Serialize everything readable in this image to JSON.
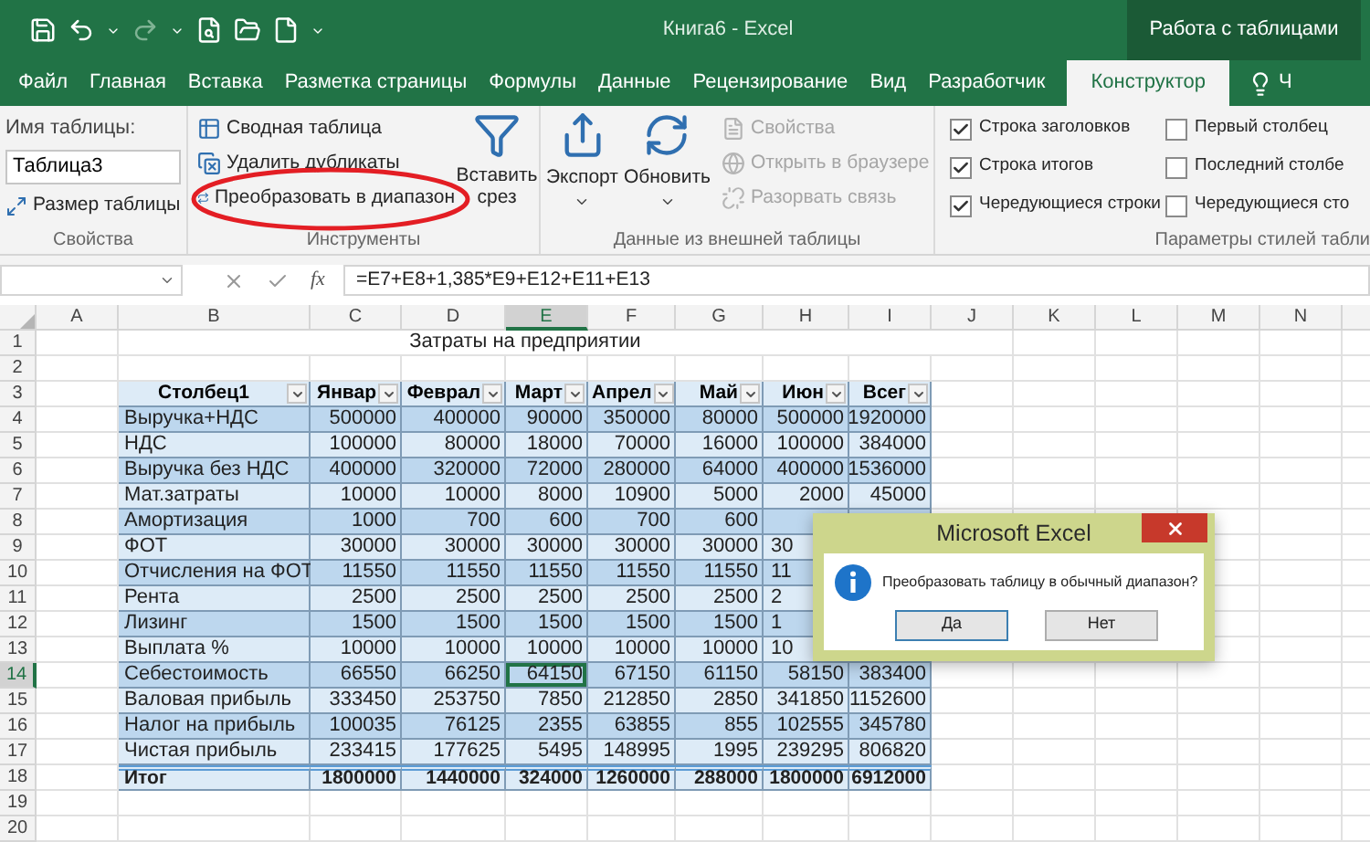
{
  "title_bar": {
    "document_title": "Книга6 - Excel",
    "context_label": "Работа с таблицами"
  },
  "ribbon_tabs": [
    {
      "label": "Файл",
      "selected": false
    },
    {
      "label": "Главная",
      "selected": false
    },
    {
      "label": "Вставка",
      "selected": false
    },
    {
      "label": "Разметка страницы",
      "selected": false
    },
    {
      "label": "Формулы",
      "selected": false
    },
    {
      "label": "Данные",
      "selected": false
    },
    {
      "label": "Рецензирование",
      "selected": false
    },
    {
      "label": "Вид",
      "selected": false
    },
    {
      "label": "Разработчик",
      "selected": false
    },
    {
      "label": "Конструктор",
      "selected": true
    }
  ],
  "tell_me": {
    "label": "Ч"
  },
  "ribbon_groups": [
    {
      "kind": "properties",
      "title": "Свойства",
      "name_label": "Имя таблицы:",
      "name_value": "Таблица3",
      "button": "Размер таблицы"
    },
    {
      "kind": "tools",
      "title": "Инструменты",
      "items": [
        {
          "label": "Сводная таблица",
          "disabled": false
        },
        {
          "label": "Удалить дубликаты",
          "disabled": false
        },
        {
          "label": "Преобразовать в диапазон",
          "disabled": false
        }
      ],
      "big_button": "Вставить срез"
    },
    {
      "kind": "external",
      "title": "Данные из внешней таблицы",
      "big_buttons": [
        "Экспорт",
        "Обновить"
      ],
      "items": [
        {
          "label": "Свойства",
          "disabled": true
        },
        {
          "label": "Открыть в браузере",
          "disabled": true
        },
        {
          "label": "Разорвать связь",
          "disabled": true
        }
      ]
    },
    {
      "kind": "style_options",
      "title": "Параметры стилей табли",
      "options": [
        {
          "label": "Строка заголовков",
          "checked": true
        },
        {
          "label": "Строка итогов",
          "checked": true
        },
        {
          "label": "Чередующиеся строки",
          "checked": true
        },
        {
          "label": "Первый столбец",
          "checked": false
        },
        {
          "label": "Последний столбе",
          "checked": false
        },
        {
          "label": "Чередующиеся сто",
          "checked": false
        }
      ]
    }
  ],
  "formula_bar": {
    "function_label": "fx",
    "formula": "=E7+E8+1,385*E9+E12+E11+E13"
  },
  "sheet": {
    "columns": [
      {
        "label": "A",
        "selected": false
      },
      {
        "label": "B",
        "selected": false
      },
      {
        "label": "C",
        "selected": false
      },
      {
        "label": "D",
        "selected": false
      },
      {
        "label": "E",
        "selected": true
      },
      {
        "label": "F",
        "selected": false
      },
      {
        "label": "G",
        "selected": false
      },
      {
        "label": "H",
        "selected": false
      },
      {
        "label": "I",
        "selected": false
      },
      {
        "label": "J",
        "selected": false
      },
      {
        "label": "K",
        "selected": false
      },
      {
        "label": "L",
        "selected": false
      },
      {
        "label": "M",
        "selected": false
      },
      {
        "label": "N",
        "selected": false
      }
    ],
    "rows": [
      {
        "number": "1",
        "selected": false,
        "kind": "title",
        "text": "Затраты на предприятии"
      },
      {
        "number": "2",
        "selected": false,
        "kind": "blank"
      },
      {
        "number": "3",
        "selected": false,
        "kind": "header",
        "cells": [
          "Столбец1",
          "Январ",
          "Феврал",
          "Март",
          "Апрел",
          "Май",
          "Июн",
          "Всег"
        ]
      },
      {
        "number": "4",
        "selected": false,
        "overlapped": false,
        "kind": "data",
        "cells": [
          "Выручка+НДС",
          "500000",
          "400000",
          "90000",
          "350000",
          "80000",
          "500000",
          "1920000"
        ]
      },
      {
        "number": "5",
        "selected": false,
        "overlapped": false,
        "kind": "data",
        "cells": [
          "НДС",
          "100000",
          "80000",
          "18000",
          "70000",
          "16000",
          "100000",
          "384000"
        ]
      },
      {
        "number": "6",
        "selected": false,
        "overlapped": false,
        "kind": "data",
        "cells": [
          "Выручка без НДС",
          "400000",
          "320000",
          "72000",
          "280000",
          "64000",
          "400000",
          "1536000"
        ]
      },
      {
        "number": "7",
        "selected": false,
        "overlapped": false,
        "kind": "data",
        "cells": [
          "Мат.затраты",
          "10000",
          "10000",
          "8000",
          "10900",
          "5000",
          "2000",
          "45000"
        ]
      },
      {
        "number": "8",
        "selected": false,
        "overlapped": true,
        "kind": "data",
        "cells": [
          "Амортизация",
          "1000",
          "700",
          "600",
          "700",
          "600"
        ]
      },
      {
        "number": "9",
        "selected": false,
        "overlapped": true,
        "kind": "data",
        "cells": [
          "ФОТ",
          "30000",
          "30000",
          "30000",
          "30000",
          "30000",
          "30"
        ]
      },
      {
        "number": "10",
        "selected": false,
        "overlapped": true,
        "kind": "data",
        "cells": [
          "Отчисления на ФОТ",
          "11550",
          "11550",
          "11550",
          "11550",
          "11550",
          "11"
        ]
      },
      {
        "number": "11",
        "selected": false,
        "overlapped": true,
        "kind": "data",
        "cells": [
          "Рента",
          "2500",
          "2500",
          "2500",
          "2500",
          "2500",
          "2"
        ]
      },
      {
        "number": "12",
        "selected": false,
        "overlapped": true,
        "kind": "data",
        "cells": [
          "Лизинг",
          "1500",
          "1500",
          "1500",
          "1500",
          "1500",
          "1"
        ]
      },
      {
        "number": "13",
        "selected": false,
        "overlapped": true,
        "kind": "data",
        "cells": [
          "Выплата %",
          "10000",
          "10000",
          "10000",
          "10000",
          "10000",
          "10"
        ]
      },
      {
        "number": "14",
        "selected": true,
        "overlapped": false,
        "kind": "data",
        "cells": [
          "Себестоимость",
          "66550",
          "66250",
          "64150",
          "67150",
          "61150",
          "58150",
          "383400"
        ]
      },
      {
        "number": "15",
        "selected": false,
        "overlapped": false,
        "kind": "data",
        "cells": [
          "Валовая прибыль",
          "333450",
          "253750",
          "7850",
          "212850",
          "2850",
          "341850",
          "1152600"
        ]
      },
      {
        "number": "16",
        "selected": false,
        "overlapped": false,
        "kind": "data",
        "cells": [
          "Налог на прибыль",
          "100035",
          "76125",
          "2355",
          "63855",
          "855",
          "102555",
          "345780"
        ]
      },
      {
        "number": "17",
        "selected": false,
        "overlapped": false,
        "kind": "data",
        "cells": [
          "Чистая прибыль",
          "233415",
          "177625",
          "5495",
          "148995",
          "1995",
          "239295",
          "806820"
        ]
      },
      {
        "number": "18",
        "selected": false,
        "kind": "total",
        "cells": [
          "Итог",
          "1800000",
          "1440000",
          "324000",
          "1260000",
          "288000",
          "1800000",
          "6912000"
        ]
      },
      {
        "number": "19",
        "selected": false,
        "kind": "blank"
      },
      {
        "number": "20",
        "selected": false,
        "kind": "blank"
      }
    ]
  },
  "dialog": {
    "title": "Microsoft Excel",
    "message": "Преобразовать таблицу в обычный диапазон?",
    "buttons": [
      {
        "label": "Да",
        "default": true
      },
      {
        "label": "Нет",
        "default": false
      }
    ]
  }
}
